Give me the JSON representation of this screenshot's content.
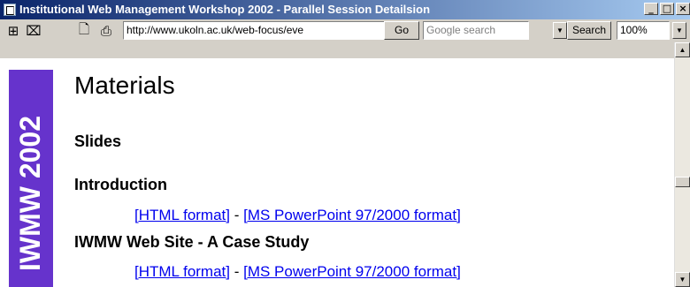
{
  "window": {
    "title": "Institutional Web Management Workshop 2002 - Parallel Session Detailsion",
    "minimize_glyph": "_",
    "maximize_glyph": "□",
    "close_glyph": "×"
  },
  "toolbar": {
    "icons": [
      "network-icon",
      "computer-icon",
      "new-page-icon",
      "print-icon"
    ],
    "address": "http://www.ukoln.ac.uk/web-focus/eve",
    "go_label": "Go",
    "search_placeholder": "Google search",
    "search_label": "Search",
    "zoom": "100%"
  },
  "page": {
    "sidebar_text": "IWMW 2002",
    "sidebar_color": "#6633cc",
    "heading": "Materials",
    "subheading": "Slides",
    "sections": [
      {
        "title": "Introduction",
        "links": [
          "[HTML format]",
          "[MS PowerPoint 97/2000 format]"
        ],
        "separator": " - "
      },
      {
        "title": "IWMW Web Site - A Case Study",
        "links": [
          "[HTML format]",
          "[MS PowerPoint 97/2000 format]"
        ],
        "separator": " - "
      }
    ]
  }
}
